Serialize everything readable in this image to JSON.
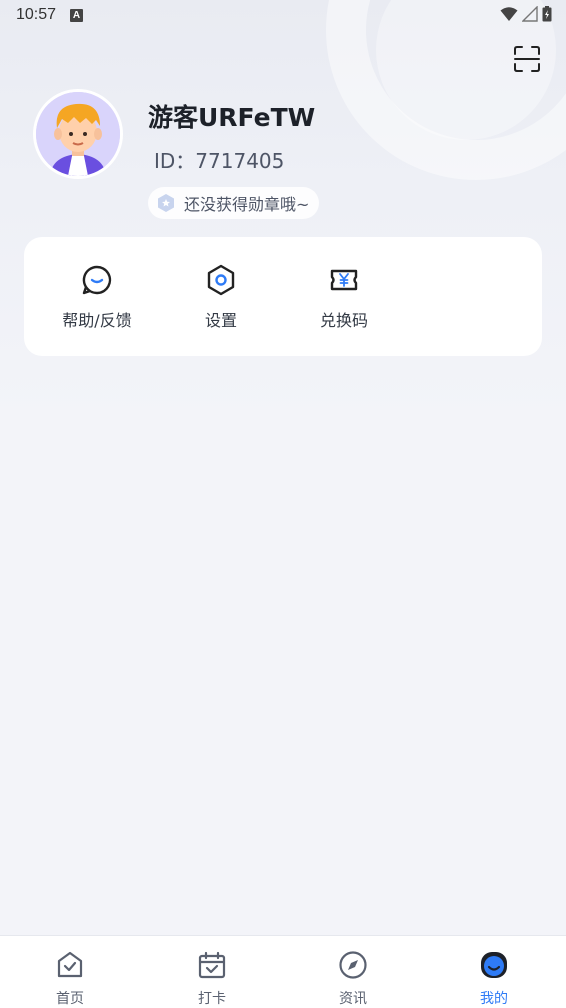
{
  "status_bar": {
    "time": "10:57",
    "notification_badge": "A"
  },
  "profile": {
    "username": "游客URFeTW",
    "user_id": "ID：7717405",
    "badge_text": "还没获得勋章哦~"
  },
  "menu": {
    "items": [
      {
        "label": "帮助/反馈",
        "icon": "chat-bubble-icon"
      },
      {
        "label": "设置",
        "icon": "hexagon-settings-icon"
      },
      {
        "label": "兑换码",
        "icon": "ticket-yen-icon"
      }
    ]
  },
  "tabbar": {
    "tabs": [
      {
        "label": "首页",
        "icon": "home-icon",
        "active": false
      },
      {
        "label": "打卡",
        "icon": "calendar-check-icon",
        "active": false
      },
      {
        "label": "资讯",
        "icon": "compass-icon",
        "active": false
      },
      {
        "label": "我的",
        "icon": "profile-face-icon",
        "active": true
      }
    ]
  },
  "colors": {
    "accent": "#2e7bf6",
    "background": "#f3f4f9",
    "card": "#ffffff"
  }
}
